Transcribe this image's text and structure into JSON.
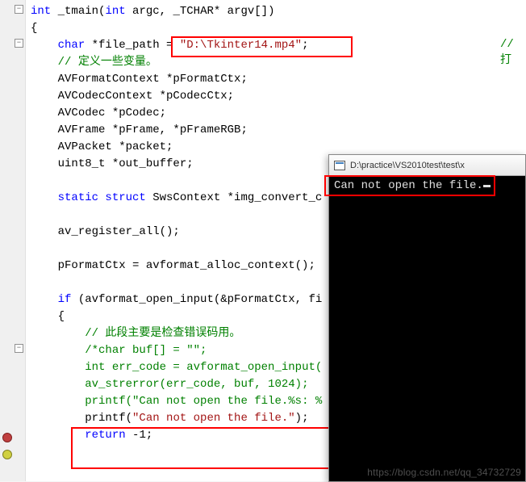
{
  "code": {
    "l1_kw": "int",
    "l1_fn": " _tmain(",
    "l1_kw2": "int",
    "l1_rest": " argc, _TCHAR* argv[])",
    "l2": "{",
    "l3_kw": "char",
    "l3_a": " *file_path = ",
    "l3_str": "\"D:\\Tkinter14.mp4\"",
    "l3_b": ";",
    "l3_trail": "// 打",
    "l4": "// 定义一些变量。",
    "l5": "AVFormatContext *pFormatCtx;",
    "l6": "AVCodecContext *pCodecCtx;",
    "l7": "AVCodec *pCodec;",
    "l8": "AVFrame *pFrame, *pFrameRGB;",
    "l9": "AVPacket *packet;",
    "l10": "uint8_t *out_buffer;",
    "l12_kw": "static struct",
    "l12_rest": " SwsContext *img_convert_c",
    "l14": "av_register_all();",
    "l16": "pFormatCtx = avformat_alloc_context();",
    "l18_kw": "if",
    "l18_rest": " (avformat_open_input(&pFormatCtx, fi",
    "l19": "{",
    "l20": "// 此段主要是检查错误码用。",
    "l21": "/*char buf[] = \"\";",
    "l22": "int err_code = avformat_open_input(",
    "l23": "av_strerror(err_code, buf, 1024);",
    "l24": "printf(\"Can not open the file.%s: %",
    "l25_a": "printf(",
    "l25_str": "\"Can not open the file.\"",
    "l25_b": ");",
    "l26_kw": "return",
    "l26_rest": " -1;"
  },
  "folds": {
    "f1": "−",
    "f2": "−",
    "f3": "−"
  },
  "console": {
    "title": "D:\\practice\\VS2010test\\test\\x",
    "output": "Can not open the file."
  },
  "watermark": "https://blog.csdn.net/qq_34732729"
}
